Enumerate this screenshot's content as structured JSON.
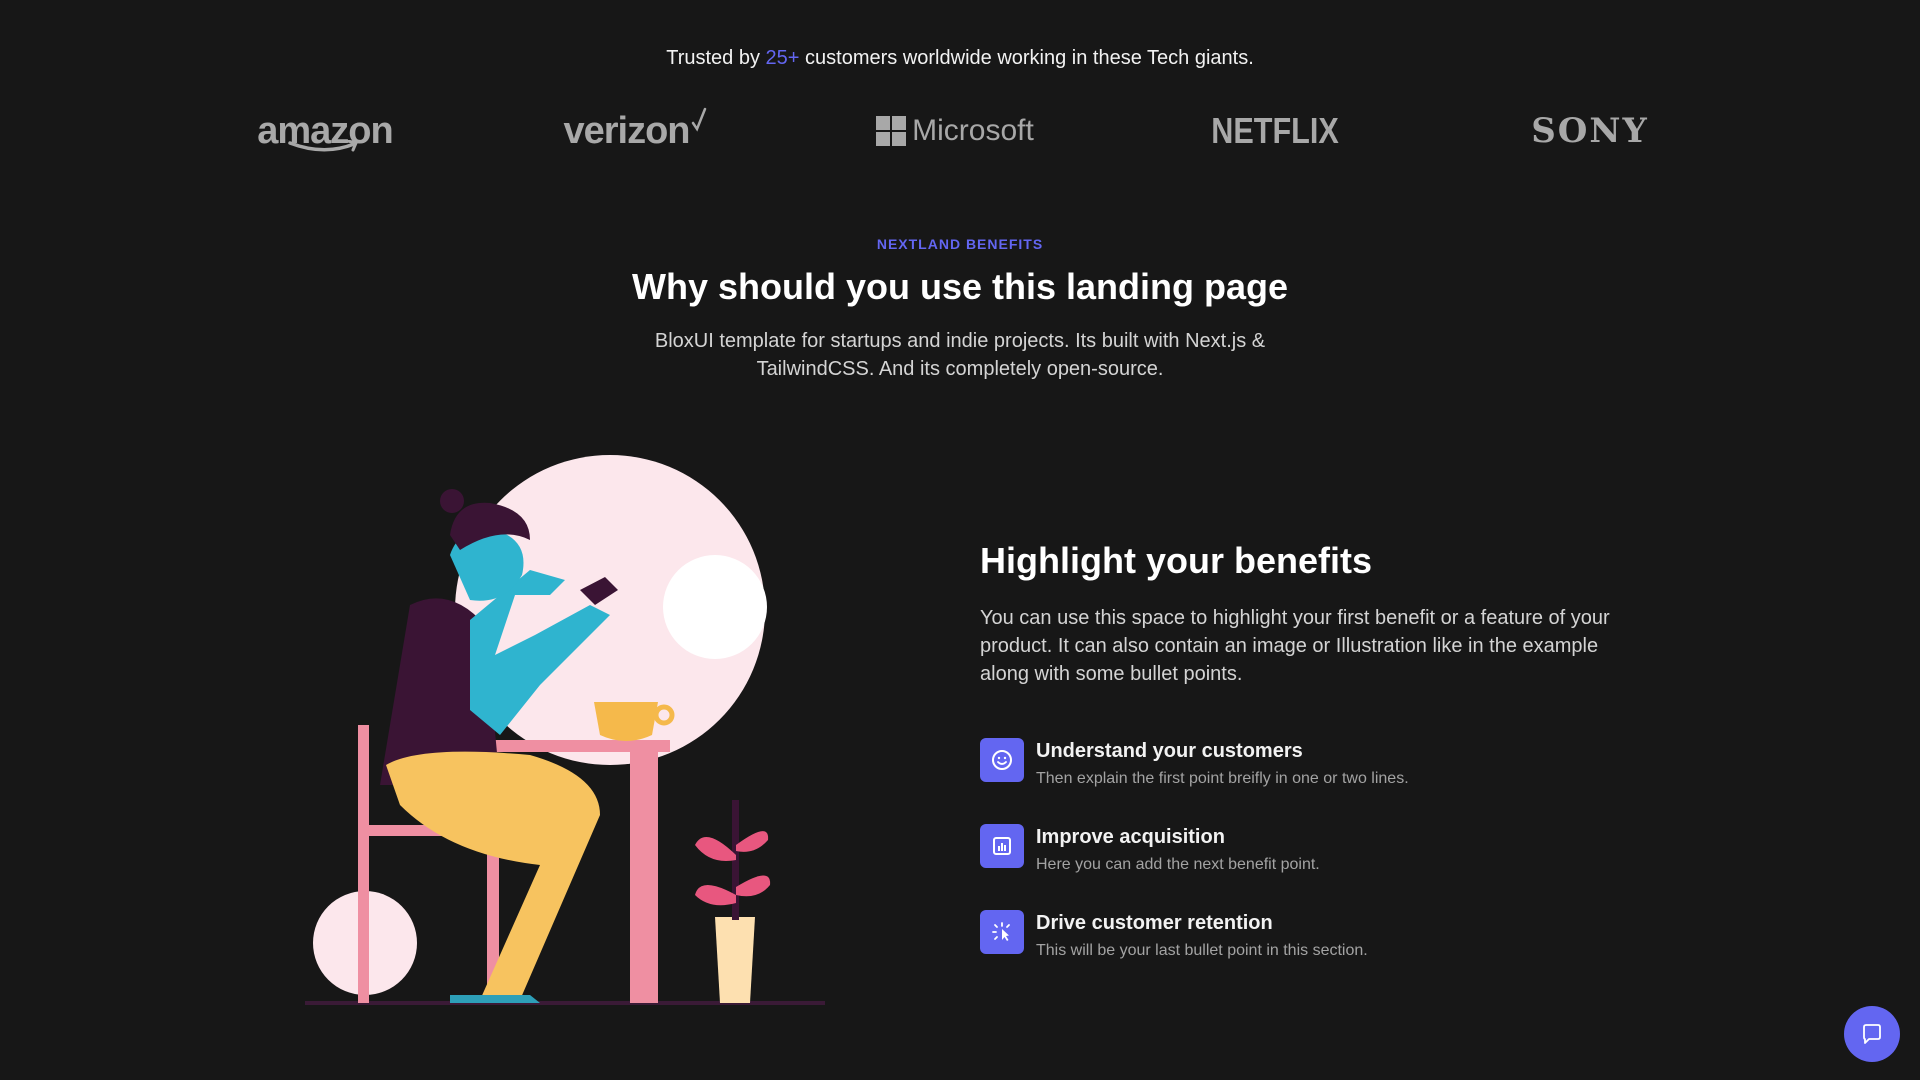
{
  "trusted": {
    "prefix": "Trusted by",
    "count": "25+",
    "suffix": "customers worldwide working in these Tech giants."
  },
  "logos": [
    "amazon",
    "verizon",
    "Microsoft",
    "NETFLIX",
    "SONY"
  ],
  "section": {
    "eyebrow": "NEXTLAND BENEFITS",
    "title": "Why should you use this landing page",
    "description": "BloxUI template for startups and indie projects. Its built with Next.js & TailwindCSS. And its completely open-source."
  },
  "benefits": {
    "title": "Highlight your benefits",
    "description": "You can use this space to highlight your first benefit or a feature of your product. It can also contain an image or Illustration like in the example along with some bullet points.",
    "items": [
      {
        "title": "Understand your customers",
        "subtitle": "Then explain the first point breifly in one or two lines.",
        "icon": "smiley-icon"
      },
      {
        "title": "Improve acquisition",
        "subtitle": "Here you can add the next benefit point.",
        "icon": "bar-chart-icon"
      },
      {
        "title": "Drive customer retention",
        "subtitle": "This will be your last bullet point in this section.",
        "icon": "cursor-click-icon"
      }
    ]
  },
  "colors": {
    "background": "#171717",
    "accent": "#6366f1",
    "logo_gray": "#a8a8a8"
  },
  "chat": {
    "icon": "chat-bubble-icon"
  }
}
